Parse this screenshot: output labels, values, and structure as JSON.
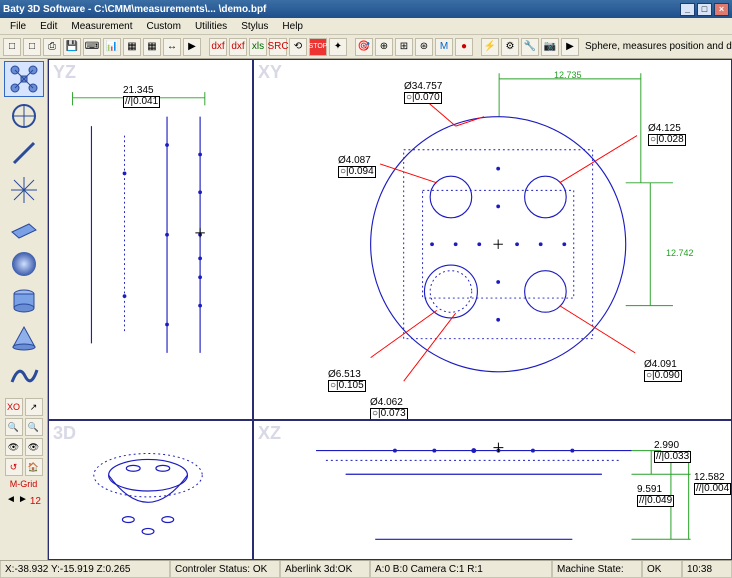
{
  "title": "Baty 3D Software - C:\\CMM\\measurements\\... \\demo.bpf",
  "window_buttons": {
    "min": "_",
    "max": "□",
    "close": "×"
  },
  "menu": [
    "File",
    "Edit",
    "Measurement",
    "Custom",
    "Utilities",
    "Stylus",
    "Help"
  ],
  "toolbar": {
    "items": [
      "□",
      "□",
      "⎙",
      "💾",
      "⌨",
      "📊",
      "▦",
      "▦",
      "↔",
      "▶",
      "|",
      "dxf",
      "dxf",
      "xls",
      "SRC",
      "⟲",
      "STOP",
      "✦",
      "|",
      "🎯",
      "⊕",
      "⊞",
      "⊛",
      "M",
      "●",
      "|",
      "⚡",
      "⚙",
      "🔧",
      "📷",
      "▶"
    ],
    "hint": "Sphere, measures position and dimensions of a sphere"
  },
  "left_tools": {
    "selected": 0,
    "names": [
      "reference",
      "circle",
      "line",
      "star",
      "plane",
      "sphere",
      "cylinder",
      "cone",
      "curve"
    ],
    "small": [
      "XO",
      "↗",
      "🔍",
      "🔍",
      "👁",
      "👁",
      "↺",
      "🏠"
    ],
    "mgrid_label": "M-Grid",
    "count": "12"
  },
  "views": {
    "yz": "YZ",
    "xy": "XY",
    "v3d": "3D",
    "xz": "XZ"
  },
  "yz": {
    "dim1": "21.345",
    "tol1": "//|0.041"
  },
  "xy": {
    "top_dim": "12.735",
    "right_dim": "12.742",
    "c_main": {
      "d": "Ø34.757",
      "t": "○|0.070"
    },
    "c_tl": {
      "d": "Ø4.087",
      "t": "○|0.094"
    },
    "c_tr": {
      "d": "Ø4.125",
      "t": "○|0.028"
    },
    "c_bl": {
      "d": "Ø6.513",
      "t": "○|0.105"
    },
    "c_bl2": {
      "d": "Ø4.062",
      "t": "○|0.073"
    },
    "c_br": {
      "d": "Ø4.091",
      "t": "○|0.090"
    }
  },
  "xz": {
    "d1": "2.990",
    "t1": "//|0.033",
    "d2": "9.591",
    "t2": "//|0.049",
    "d3": "12.582",
    "t3": "//|0.004"
  },
  "status": {
    "coords": "X:-38.932 Y:-15.919 Z:0.265",
    "ctrl": "Controler Status: OK",
    "aber": "Aberlink 3d:OK",
    "acr": "A:0  B:0   Camera   C:1  R:1",
    "mstate": "Machine State:",
    "ok": "OK",
    "time": "10:38"
  }
}
